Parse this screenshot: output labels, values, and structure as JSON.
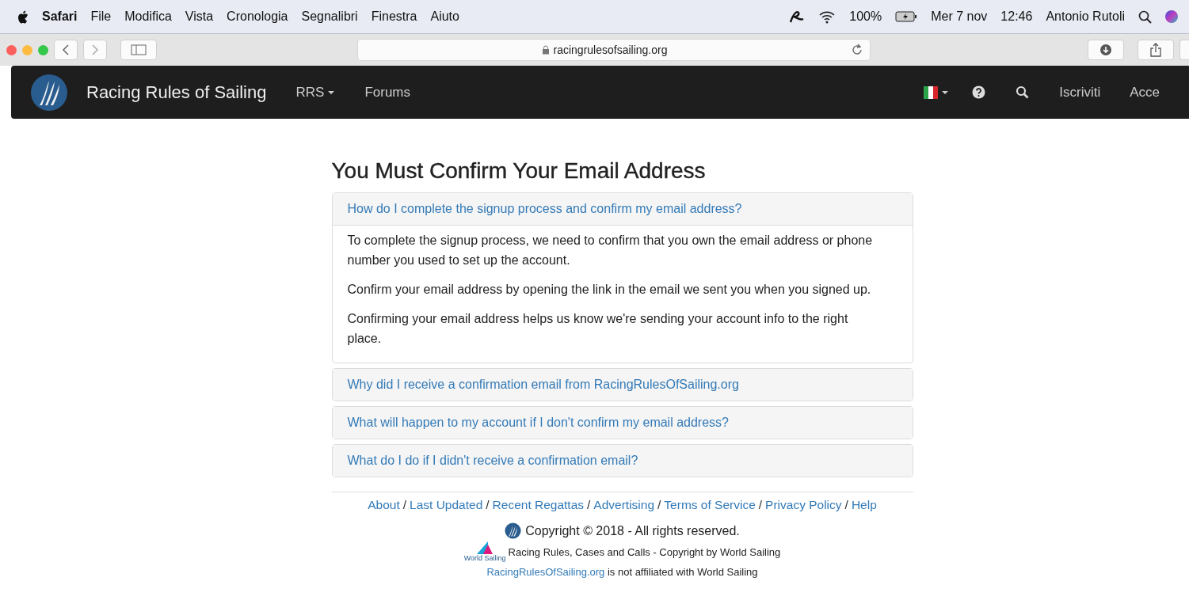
{
  "menubar": {
    "app": "Safari",
    "items": [
      "File",
      "Modifica",
      "Vista",
      "Cronologia",
      "Segnalibri",
      "Finestra",
      "Aiuto"
    ],
    "battery": "100%",
    "date": "Mer 7 nov",
    "time": "12:46",
    "user": "Antonio Rutoli"
  },
  "browser": {
    "url": "racingrulesofsailing.org"
  },
  "navbar": {
    "brand": "Racing Rules of Sailing",
    "links": [
      {
        "label": "RRS",
        "dropdown": true
      },
      {
        "label": "Forums",
        "dropdown": false
      }
    ],
    "right_links": [
      "Iscriviti",
      "Acce"
    ]
  },
  "page": {
    "title": "You Must Confirm Your Email Address",
    "faq": [
      {
        "question": "How do I complete the signup process and confirm my email address?",
        "expanded": true,
        "answer": [
          "To complete the signup process, we need to confirm that you own the email address or phone number you used to set up the account.",
          "Confirm your email address by opening the link in the email we sent you when you signed up.",
          "Confirming your email address helps us know we're sending your account info to the right place."
        ]
      },
      {
        "question": "Why did I receive a confirmation email from RacingRulesOfSailing.org",
        "expanded": false
      },
      {
        "question": "What will happen to my account if I don't confirm my email address?",
        "expanded": false
      },
      {
        "question": "What do I do if I didn't receive a confirmation email?",
        "expanded": false
      }
    ]
  },
  "footer": {
    "separator": "/",
    "links": [
      "About",
      "Last Updated",
      "Recent Regattas",
      "Advertising",
      "Terms of Service",
      "Privacy Policy",
      "Help"
    ],
    "copyright": "Copyright © 2018 - All rights reserved.",
    "ws_logo_text": "World Sailing",
    "ws_copyright": "Racing Rules, Cases and Calls - Copyright by World Sailing",
    "affiliation_link": "RacingRulesOfSailing.org",
    "affiliation_text": "is not affiliated with World Sailing"
  }
}
